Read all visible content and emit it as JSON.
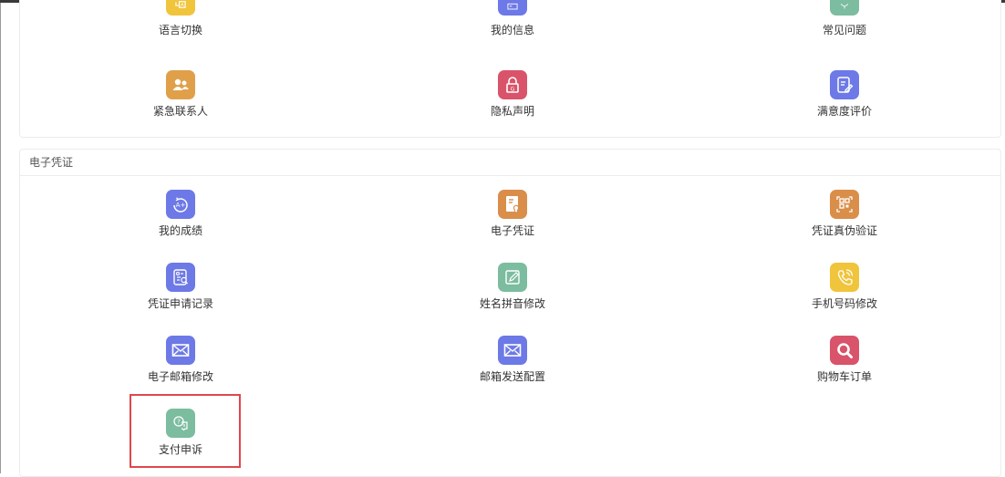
{
  "section_top": {
    "items": [
      {
        "label": "语言切换",
        "icon": "language-icon",
        "color": "#f0c43b"
      },
      {
        "label": "我的信息",
        "icon": "user-info-icon",
        "color": "#6d79e6"
      },
      {
        "label": "常见问题",
        "icon": "faq-icon",
        "color": "#7cbc9f"
      },
      {
        "label": "紧急联系人",
        "icon": "contacts-icon",
        "color": "#e0a04a"
      },
      {
        "label": "隐私声明",
        "icon": "lock-icon",
        "color": "#d9536a"
      },
      {
        "label": "满意度评价",
        "icon": "evaluation-icon",
        "color": "#6d79e6"
      }
    ]
  },
  "section_credentials": {
    "title": "电子凭证",
    "items": [
      {
        "label": "我的成绩",
        "icon": "grade-icon",
        "color": "#6d79e6"
      },
      {
        "label": "电子凭证",
        "icon": "certificate-icon",
        "color": "#d98e4a"
      },
      {
        "label": "凭证真伪验证",
        "icon": "qr-verify-icon",
        "color": "#d98e4a"
      },
      {
        "label": "凭证申请记录",
        "icon": "application-record-icon",
        "color": "#6d79e6"
      },
      {
        "label": "姓名拼音修改",
        "icon": "edit-icon",
        "color": "#7cbc9f"
      },
      {
        "label": "手机号码修改",
        "icon": "phone-icon",
        "color": "#f0c43b"
      },
      {
        "label": "电子邮箱修改",
        "icon": "mail-icon",
        "color": "#6d79e6"
      },
      {
        "label": "邮箱发送配置",
        "icon": "mail-send-icon",
        "color": "#6d79e6"
      },
      {
        "label": "购物车订单",
        "icon": "search-icon",
        "color": "#d9536a"
      },
      {
        "label": "支付申诉",
        "icon": "payment-appeal-icon",
        "color": "#7cbc9f"
      }
    ]
  },
  "highlight_color": "#e0474c"
}
